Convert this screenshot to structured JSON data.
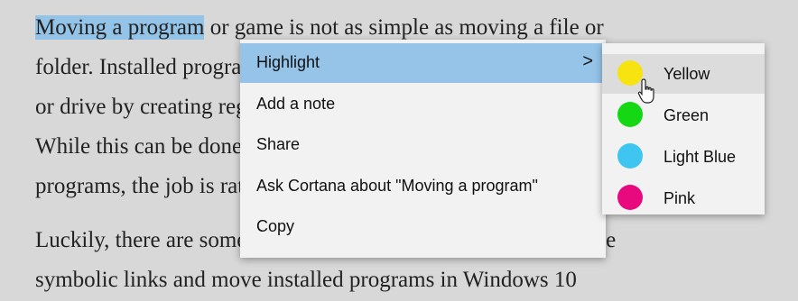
{
  "document": {
    "lines": [
      {
        "selected": "Moving a program",
        "rest": " or game is not as simple as moving a file or"
      },
      {
        "text": "folder. Installed programs are linked to a specific location"
      },
      {
        "text": "or drive by creating registry entries and symbolic links. Some"
      },
      {
        "text": "While this can be done manually or with the help of third-party"
      },
      {
        "text": "programs, the job is rather tedious and error prone."
      },
      {
        "text": "Luckily, there are some free tools you can use to help you create"
      },
      {
        "text": "symbolic links and move installed programs in Windows 10"
      }
    ]
  },
  "context_menu": {
    "items": [
      {
        "label": "Highlight",
        "has_submenu": true,
        "chevron": ">"
      },
      {
        "label": "Add a note"
      },
      {
        "label": "Share"
      },
      {
        "label": "Ask Cortana about \"Moving a program\""
      },
      {
        "label": "Copy"
      }
    ]
  },
  "highlight_submenu": {
    "items": [
      {
        "label": "Yellow",
        "color": "#f6e30f"
      },
      {
        "label": "Green",
        "color": "#13d813"
      },
      {
        "label": "Light Blue",
        "color": "#3ec6f1"
      },
      {
        "label": "Pink",
        "color": "#e8097e"
      }
    ]
  }
}
